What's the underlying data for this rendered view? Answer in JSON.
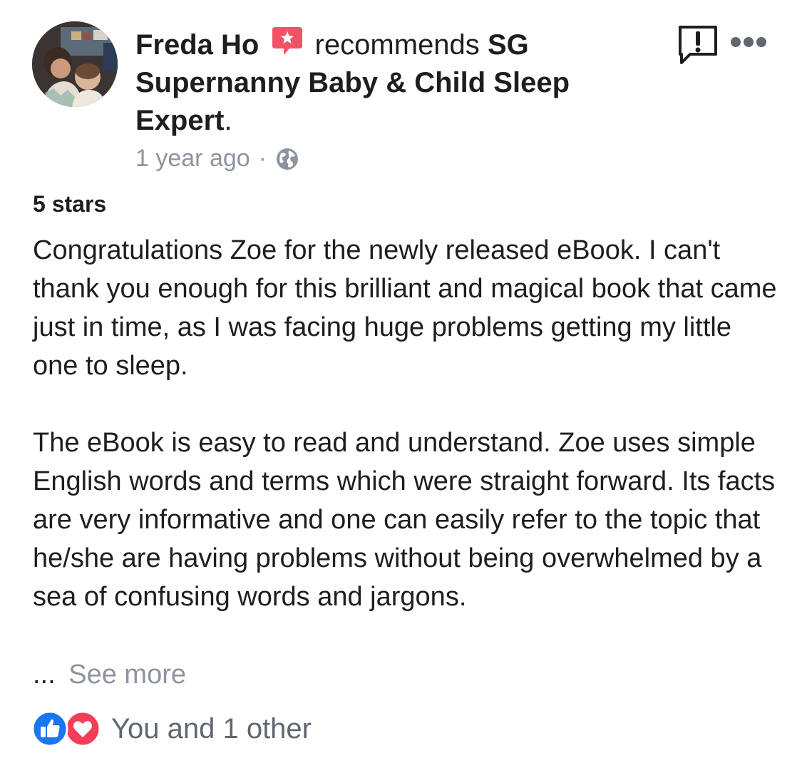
{
  "post": {
    "author": "Freda Ho",
    "action": "recommends",
    "page_name": "SG Supernanny Baby & Child Sleep Expert",
    "page_suffix": ".",
    "timestamp": "1 year ago",
    "separator": "·",
    "privacy_icon": "globe-icon",
    "recommend_icon": "recommendation-star-icon",
    "rating": "5 stars",
    "paragraphs": [
      "Congratulations Zoe for the newly released eBook. I can't thank you enough for this brilliant and magical book that came just in time, as I was facing huge problems getting my little one to sleep.",
      "The eBook is easy to read and understand.  Zoe uses simple English words and terms which were straight forward. Its facts are very informative and one can easily refer to the topic that he/she are having problems without being overwhelmed by a sea of confusing words and jargons."
    ],
    "ellipsis": "...",
    "see_more": "See more",
    "reactions_text": "You and 1 other"
  },
  "icons": {
    "report": "report-icon",
    "more": "more-options-icon",
    "like": "like-reaction-icon",
    "love": "love-reaction-icon"
  },
  "colors": {
    "text_primary": "#1c1e21",
    "text_secondary": "#8d949e",
    "recommend_red": "#f25268",
    "like_blue": "#1877f2",
    "love_red": "#f33e58"
  }
}
